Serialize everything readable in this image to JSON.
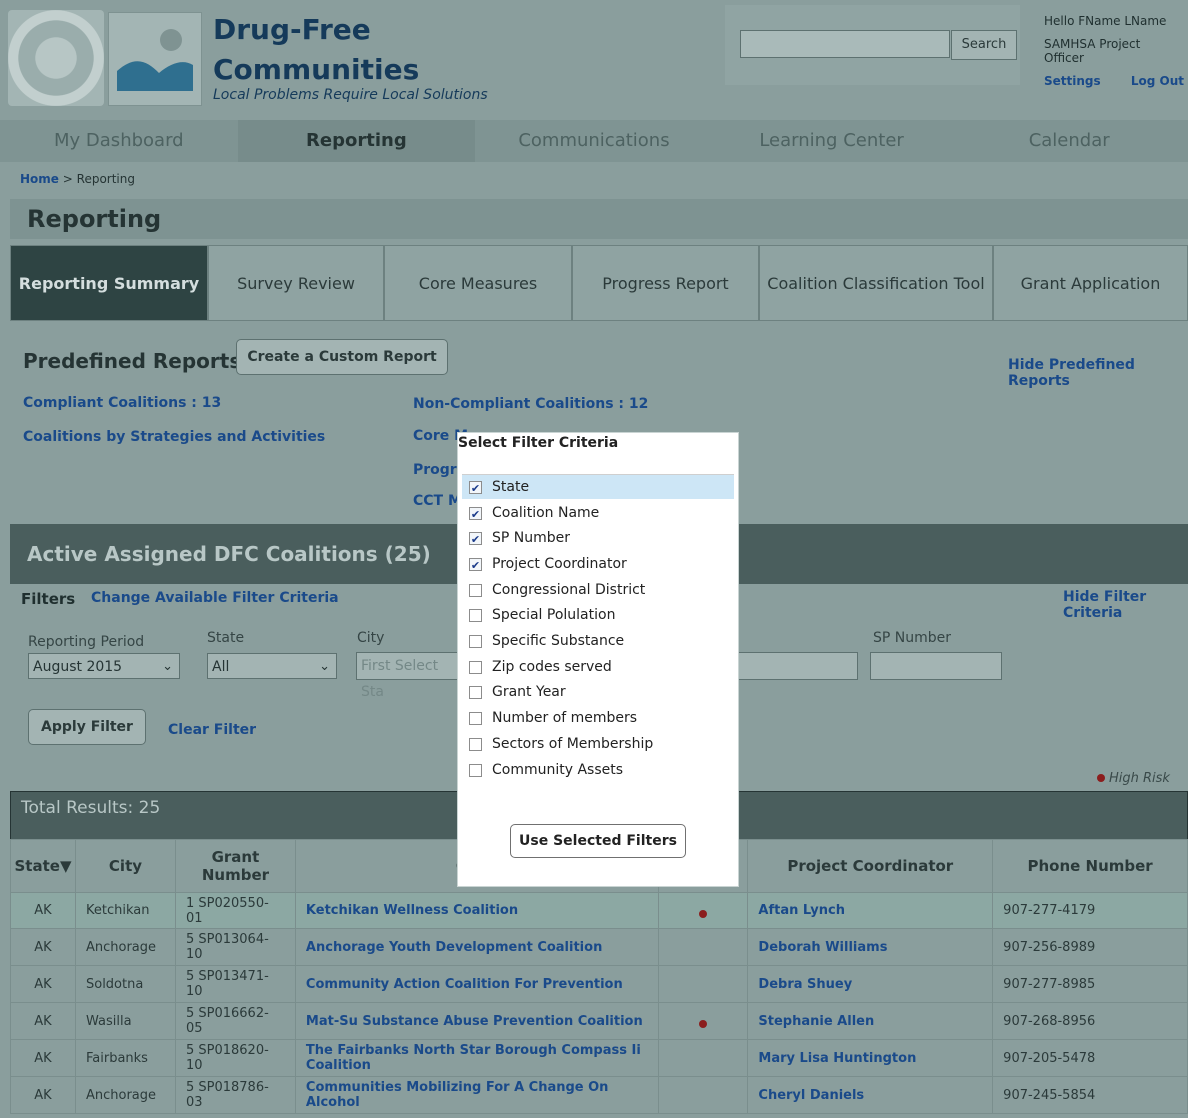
{
  "brand": {
    "title_line1": "Drug-Free",
    "title_line2": "Communities",
    "tagline": "Local Problems Require Local Solutions"
  },
  "search": {
    "button": "Search",
    "value": ""
  },
  "user": {
    "greeting": "Hello FName LName",
    "role": "SAMHSA Project Officer",
    "settings": "Settings",
    "logout": "Log Out"
  },
  "nav": [
    {
      "label": "My Dashboard"
    },
    {
      "label": "Reporting"
    },
    {
      "label": "Communications"
    },
    {
      "label": "Learning Center"
    },
    {
      "label": "Calendar"
    }
  ],
  "breadcrumb": {
    "home": "Home",
    "sep": ">",
    "current": "Reporting"
  },
  "page_title": "Reporting",
  "tabs": [
    {
      "label": "Reporting Summary"
    },
    {
      "label": "Survey Review"
    },
    {
      "label": "Core Measures"
    },
    {
      "label": "Progress Report"
    },
    {
      "label": "Coalition Classification Tool"
    },
    {
      "label": "Grant Application"
    }
  ],
  "predefined": {
    "title": "Predefined Reports",
    "custom_button": "Create a Custom Report",
    "hide_link": "Hide Predefined Reports",
    "left_links": [
      "Compliant Coalitions : 13",
      "Coalitions by Strategies and Activities"
    ],
    "right_links": [
      "Non-Compliant Coalitions : 12",
      "Core M",
      "Progre",
      "CCT M"
    ]
  },
  "active": {
    "title": "Active Assigned DFC Coalitions (25)",
    "filters_label": "Filters",
    "change_filter": "Change Available Filter Criteria",
    "hide_filter": "Hide Filter Criteria",
    "reporting_period_label": "Reporting Period",
    "reporting_period_value": "August 2015",
    "state_label": "State",
    "state_value": "All",
    "city_label": "City",
    "city_placeholder": "First Select Sta",
    "sp_label": "SP Number",
    "apply": "Apply Filter",
    "clear": "Clear Filter",
    "high_risk": "High Risk"
  },
  "results": {
    "title": "Total Results: 25",
    "columns": [
      "State",
      "City",
      "Grant Number",
      "Coali",
      "",
      "Project Coordinator",
      "Phone Number"
    ],
    "rows": [
      {
        "state": "AK",
        "city": "Ketchikan",
        "grant": "1 SP020550-01",
        "coalition": "Ketchikan Wellness Coalition",
        "risk": true,
        "coordinator": "Aftan Lynch",
        "phone": "907-277-4179"
      },
      {
        "state": "AK",
        "city": "Anchorage",
        "grant": "5 SP013064-10",
        "coalition": "Anchorage Youth Development Coalition",
        "risk": false,
        "coordinator": "Deborah Williams",
        "phone": "907-256-8989"
      },
      {
        "state": "AK",
        "city": "Soldotna",
        "grant": "5 SP013471-10",
        "coalition": "Community Action Coalition For Prevention",
        "risk": false,
        "coordinator": "Debra Shuey",
        "phone": "907-277-8985"
      },
      {
        "state": "AK",
        "city": "Wasilla",
        "grant": "5 SP016662-05",
        "coalition": "Mat-Su Substance Abuse Prevention Coalition",
        "risk": true,
        "coordinator": "Stephanie Allen",
        "phone": "907-268-8956"
      },
      {
        "state": "AK",
        "city": "Fairbanks",
        "grant": "5 SP018620-10",
        "coalition": "The Fairbanks North Star Borough Compass Ii Coalition",
        "risk": false,
        "coordinator": "Mary Lisa Huntington",
        "phone": "907-205-5478"
      },
      {
        "state": "AK",
        "city": "Anchorage",
        "grant": "5 SP018786-03",
        "coalition": "Communities Mobilizing For A Change On Alcohol",
        "risk": false,
        "coordinator": "Cheryl Daniels",
        "phone": "907-245-5854"
      }
    ]
  },
  "modal": {
    "title": "Select Filter Criteria",
    "options": [
      {
        "label": "State",
        "checked": true
      },
      {
        "label": "Coalition Name",
        "checked": true
      },
      {
        "label": "SP Number",
        "checked": true
      },
      {
        "label": "Project Coordinator",
        "checked": true
      },
      {
        "label": "Congressional District",
        "checked": false
      },
      {
        "label": "Special Polulation",
        "checked": false
      },
      {
        "label": "Specific Substance",
        "checked": false
      },
      {
        "label": "Zip codes served",
        "checked": false
      },
      {
        "label": "Grant Year",
        "checked": false
      },
      {
        "label": "Number of members",
        "checked": false
      },
      {
        "label": "Sectors of Membership",
        "checked": false
      },
      {
        "label": "Community Assets",
        "checked": false
      }
    ],
    "button": "Use Selected Filters"
  },
  "icons": {
    "sort": "sort-down-icon",
    "dropdown": "chevron-down-icon",
    "checkmark": "check-icon"
  },
  "colors": {
    "link": "#1a4a8a",
    "active_tab": "#2e4443",
    "risk": "#8b1d1d",
    "highlight": "#cde6f6"
  }
}
